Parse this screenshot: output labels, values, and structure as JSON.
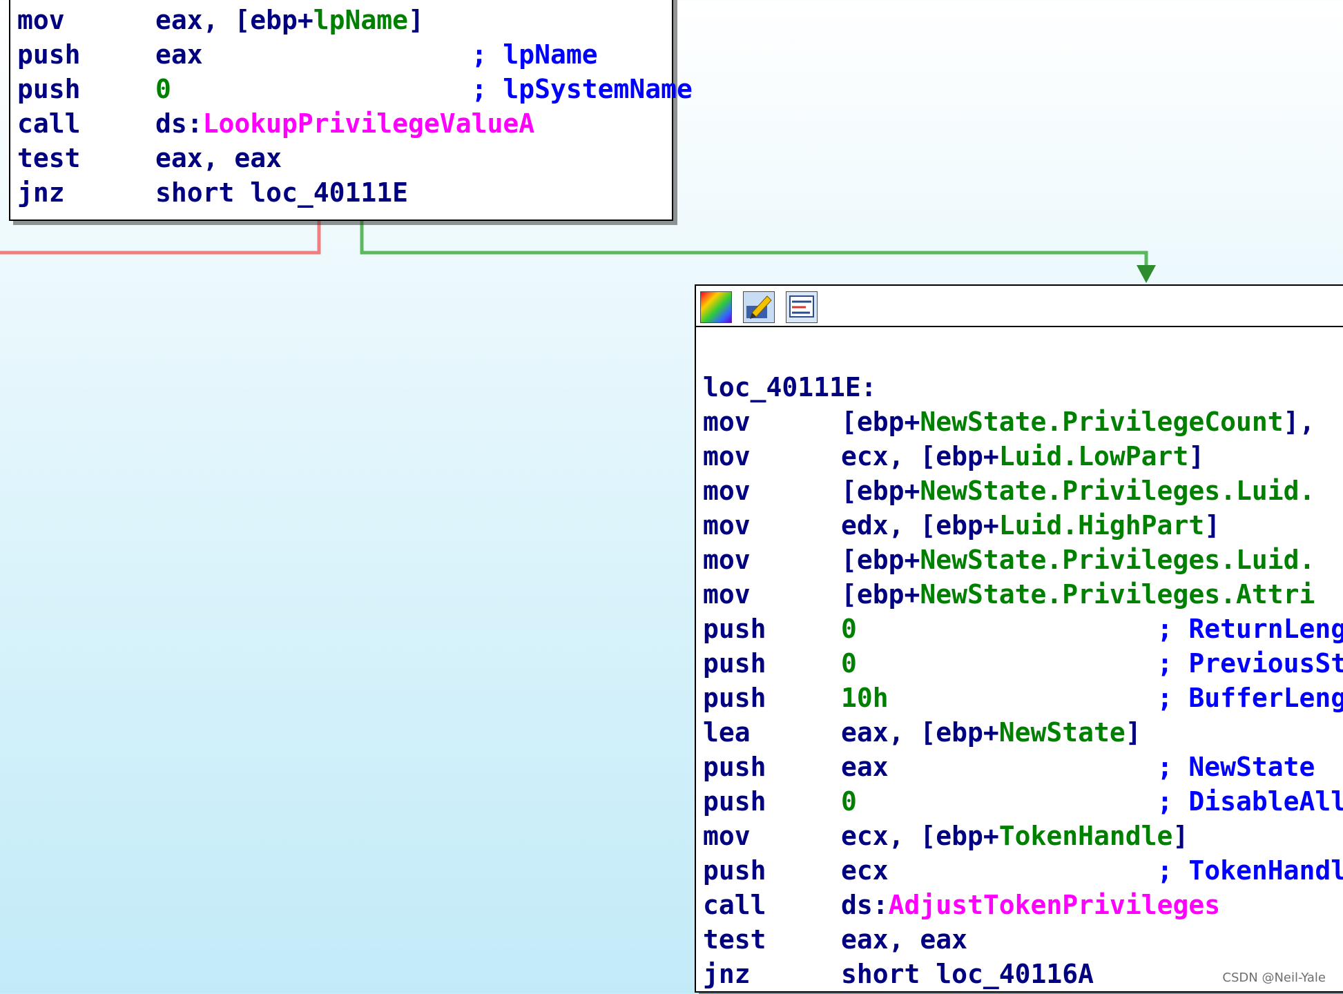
{
  "graph": {
    "top_block": {
      "lines": [
        {
          "mnem": "mov",
          "ops": [
            {
              "t": "eax, [ebp+",
              "c": "reg"
            },
            {
              "t": "lpName",
              "c": "var"
            },
            {
              "t": "]",
              "c": "reg"
            }
          ]
        },
        {
          "mnem": "push",
          "ops": [
            {
              "t": "eax                 ",
              "c": "reg"
            },
            {
              "t": "; lpName",
              "c": "cmt"
            }
          ]
        },
        {
          "mnem": "push",
          "ops": [
            {
              "t": "0",
              "c": "num"
            },
            {
              "t": "                   ",
              "c": "reg"
            },
            {
              "t": "; lpSystemName",
              "c": "cmt"
            }
          ]
        },
        {
          "mnem": "call",
          "ops": [
            {
              "t": "ds:",
              "c": "reg"
            },
            {
              "t": "LookupPrivilegeValueA",
              "c": "imp"
            }
          ]
        },
        {
          "mnem": "test",
          "ops": [
            {
              "t": "eax, eax",
              "c": "reg"
            }
          ]
        },
        {
          "mnem": "jnz",
          "ops": [
            {
              "t": "short loc_40111E",
              "c": "reg"
            }
          ]
        }
      ]
    },
    "bottom_block": {
      "label": "loc_40111E:",
      "lines": [
        {
          "mnem": "mov",
          "ops": [
            {
              "t": "[ebp+",
              "c": "reg"
            },
            {
              "t": "NewState.PrivilegeCount",
              "c": "var"
            },
            {
              "t": "],",
              "c": "reg"
            }
          ]
        },
        {
          "mnem": "mov",
          "ops": [
            {
              "t": "ecx, [ebp+",
              "c": "reg"
            },
            {
              "t": "Luid.LowPart",
              "c": "var"
            },
            {
              "t": "]",
              "c": "reg"
            }
          ]
        },
        {
          "mnem": "mov",
          "ops": [
            {
              "t": "[ebp+",
              "c": "reg"
            },
            {
              "t": "NewState.Privileges.Luid.",
              "c": "var"
            }
          ]
        },
        {
          "mnem": "mov",
          "ops": [
            {
              "t": "edx, [ebp+",
              "c": "reg"
            },
            {
              "t": "Luid.HighPart",
              "c": "var"
            },
            {
              "t": "]",
              "c": "reg"
            }
          ]
        },
        {
          "mnem": "mov",
          "ops": [
            {
              "t": "[ebp+",
              "c": "reg"
            },
            {
              "t": "NewState.Privileges.Luid.",
              "c": "var"
            }
          ]
        },
        {
          "mnem": "mov",
          "ops": [
            {
              "t": "[ebp+",
              "c": "reg"
            },
            {
              "t": "NewState.Privileges.Attri",
              "c": "var"
            }
          ]
        },
        {
          "mnem": "push",
          "ops": [
            {
              "t": "0",
              "c": "num"
            },
            {
              "t": "                   ",
              "c": "reg"
            },
            {
              "t": "; ReturnLength",
              "c": "cmt"
            }
          ]
        },
        {
          "mnem": "push",
          "ops": [
            {
              "t": "0",
              "c": "num"
            },
            {
              "t": "                   ",
              "c": "reg"
            },
            {
              "t": "; PreviousStat",
              "c": "cmt"
            }
          ]
        },
        {
          "mnem": "push",
          "ops": [
            {
              "t": "10h",
              "c": "num"
            },
            {
              "t": "                 ",
              "c": "reg"
            },
            {
              "t": "; BufferLength",
              "c": "cmt"
            }
          ]
        },
        {
          "mnem": "lea",
          "ops": [
            {
              "t": "eax, [ebp+",
              "c": "reg"
            },
            {
              "t": "NewState",
              "c": "var"
            },
            {
              "t": "]",
              "c": "reg"
            }
          ]
        },
        {
          "mnem": "push",
          "ops": [
            {
              "t": "eax                 ",
              "c": "reg"
            },
            {
              "t": "; NewState",
              "c": "cmt"
            }
          ]
        },
        {
          "mnem": "push",
          "ops": [
            {
              "t": "0",
              "c": "num"
            },
            {
              "t": "                   ",
              "c": "reg"
            },
            {
              "t": "; DisableAllPr",
              "c": "cmt"
            }
          ]
        },
        {
          "mnem": "mov",
          "ops": [
            {
              "t": "ecx, [ebp+",
              "c": "reg"
            },
            {
              "t": "TokenHandle",
              "c": "var"
            },
            {
              "t": "]",
              "c": "reg"
            }
          ]
        },
        {
          "mnem": "push",
          "ops": [
            {
              "t": "ecx                 ",
              "c": "reg"
            },
            {
              "t": "; TokenHandle",
              "c": "cmt"
            }
          ]
        },
        {
          "mnem": "call",
          "ops": [
            {
              "t": "ds:",
              "c": "reg"
            },
            {
              "t": "AdjustTokenPrivileges",
              "c": "imp"
            }
          ]
        },
        {
          "mnem": "test",
          "ops": [
            {
              "t": "eax, eax",
              "c": "reg"
            }
          ]
        },
        {
          "mnem": "jnz",
          "ops": [
            {
              "t": "short loc_40116A",
              "c": "reg"
            }
          ]
        }
      ]
    },
    "toolbar_icons": [
      "color-palette-icon",
      "edit-pencil-icon",
      "graph-overview-icon"
    ],
    "edge_colors": {
      "false_branch": "#f08080",
      "true_branch": "#5cb85c",
      "arrow": "#2e8b2e"
    }
  },
  "watermark": "CSDN @Neil-Yale"
}
